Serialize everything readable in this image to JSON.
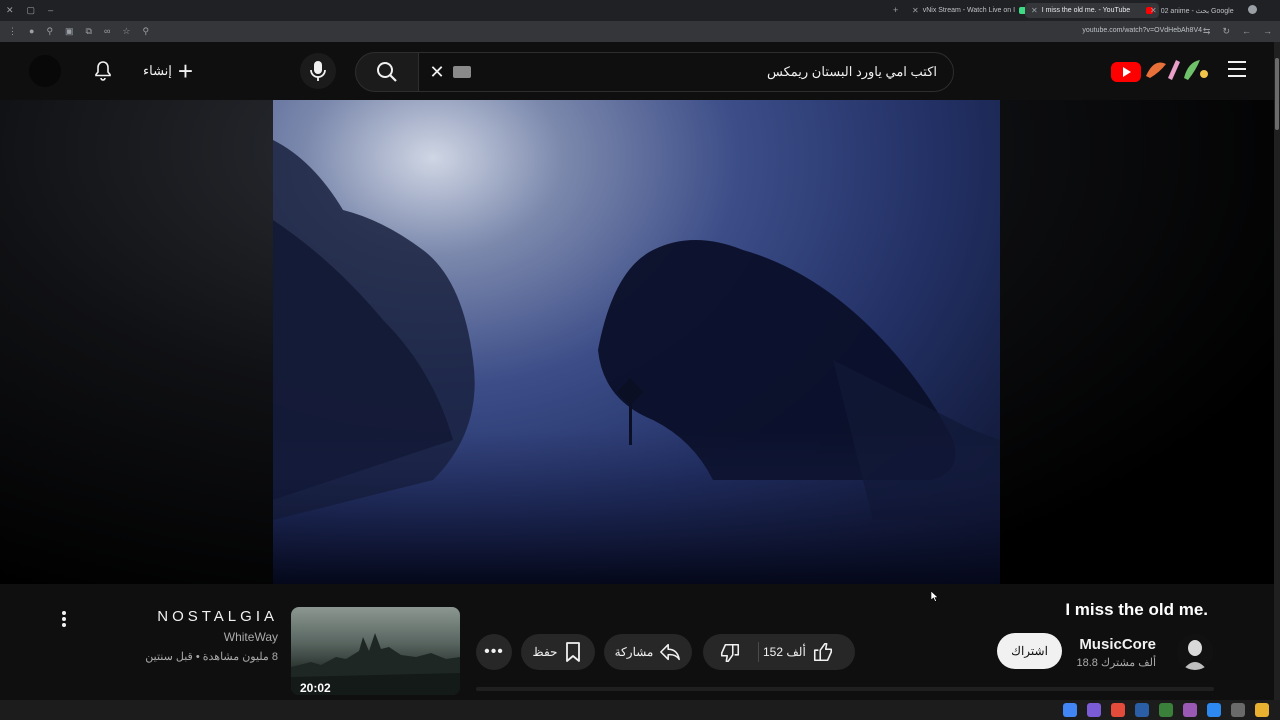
{
  "browser": {
    "tabs": [
      {
        "title": "vNix Stream - Watch Live on I",
        "active": false
      },
      {
        "title": "I miss the old me. - YouTube",
        "active": true
      },
      {
        "title": "02 anime - بحث Google",
        "active": false
      }
    ],
    "url": "youtube.com/watch?v=OVdHebAh8V4"
  },
  "header": {
    "create_label": "إنشاء",
    "search_query": "اكتب امي ياورد البستان ريمكس"
  },
  "video": {
    "title": "I miss the old me.",
    "channel": "MusicCore",
    "subscribers": "18.8 ألف مشترك",
    "subscribe_label": "اشتراك",
    "likes": "152 ألف",
    "share_label": "مشاركة",
    "save_label": "حفظ"
  },
  "next_video": {
    "title": "NOSTALGIA",
    "channel": "WhiteWay",
    "meta": "8 مليون مشاهدة • قبل سنتين",
    "duration": "20:02"
  },
  "colors": {
    "accent": "#ff0000",
    "background": "#0f0f0f",
    "pill": "#272727"
  }
}
